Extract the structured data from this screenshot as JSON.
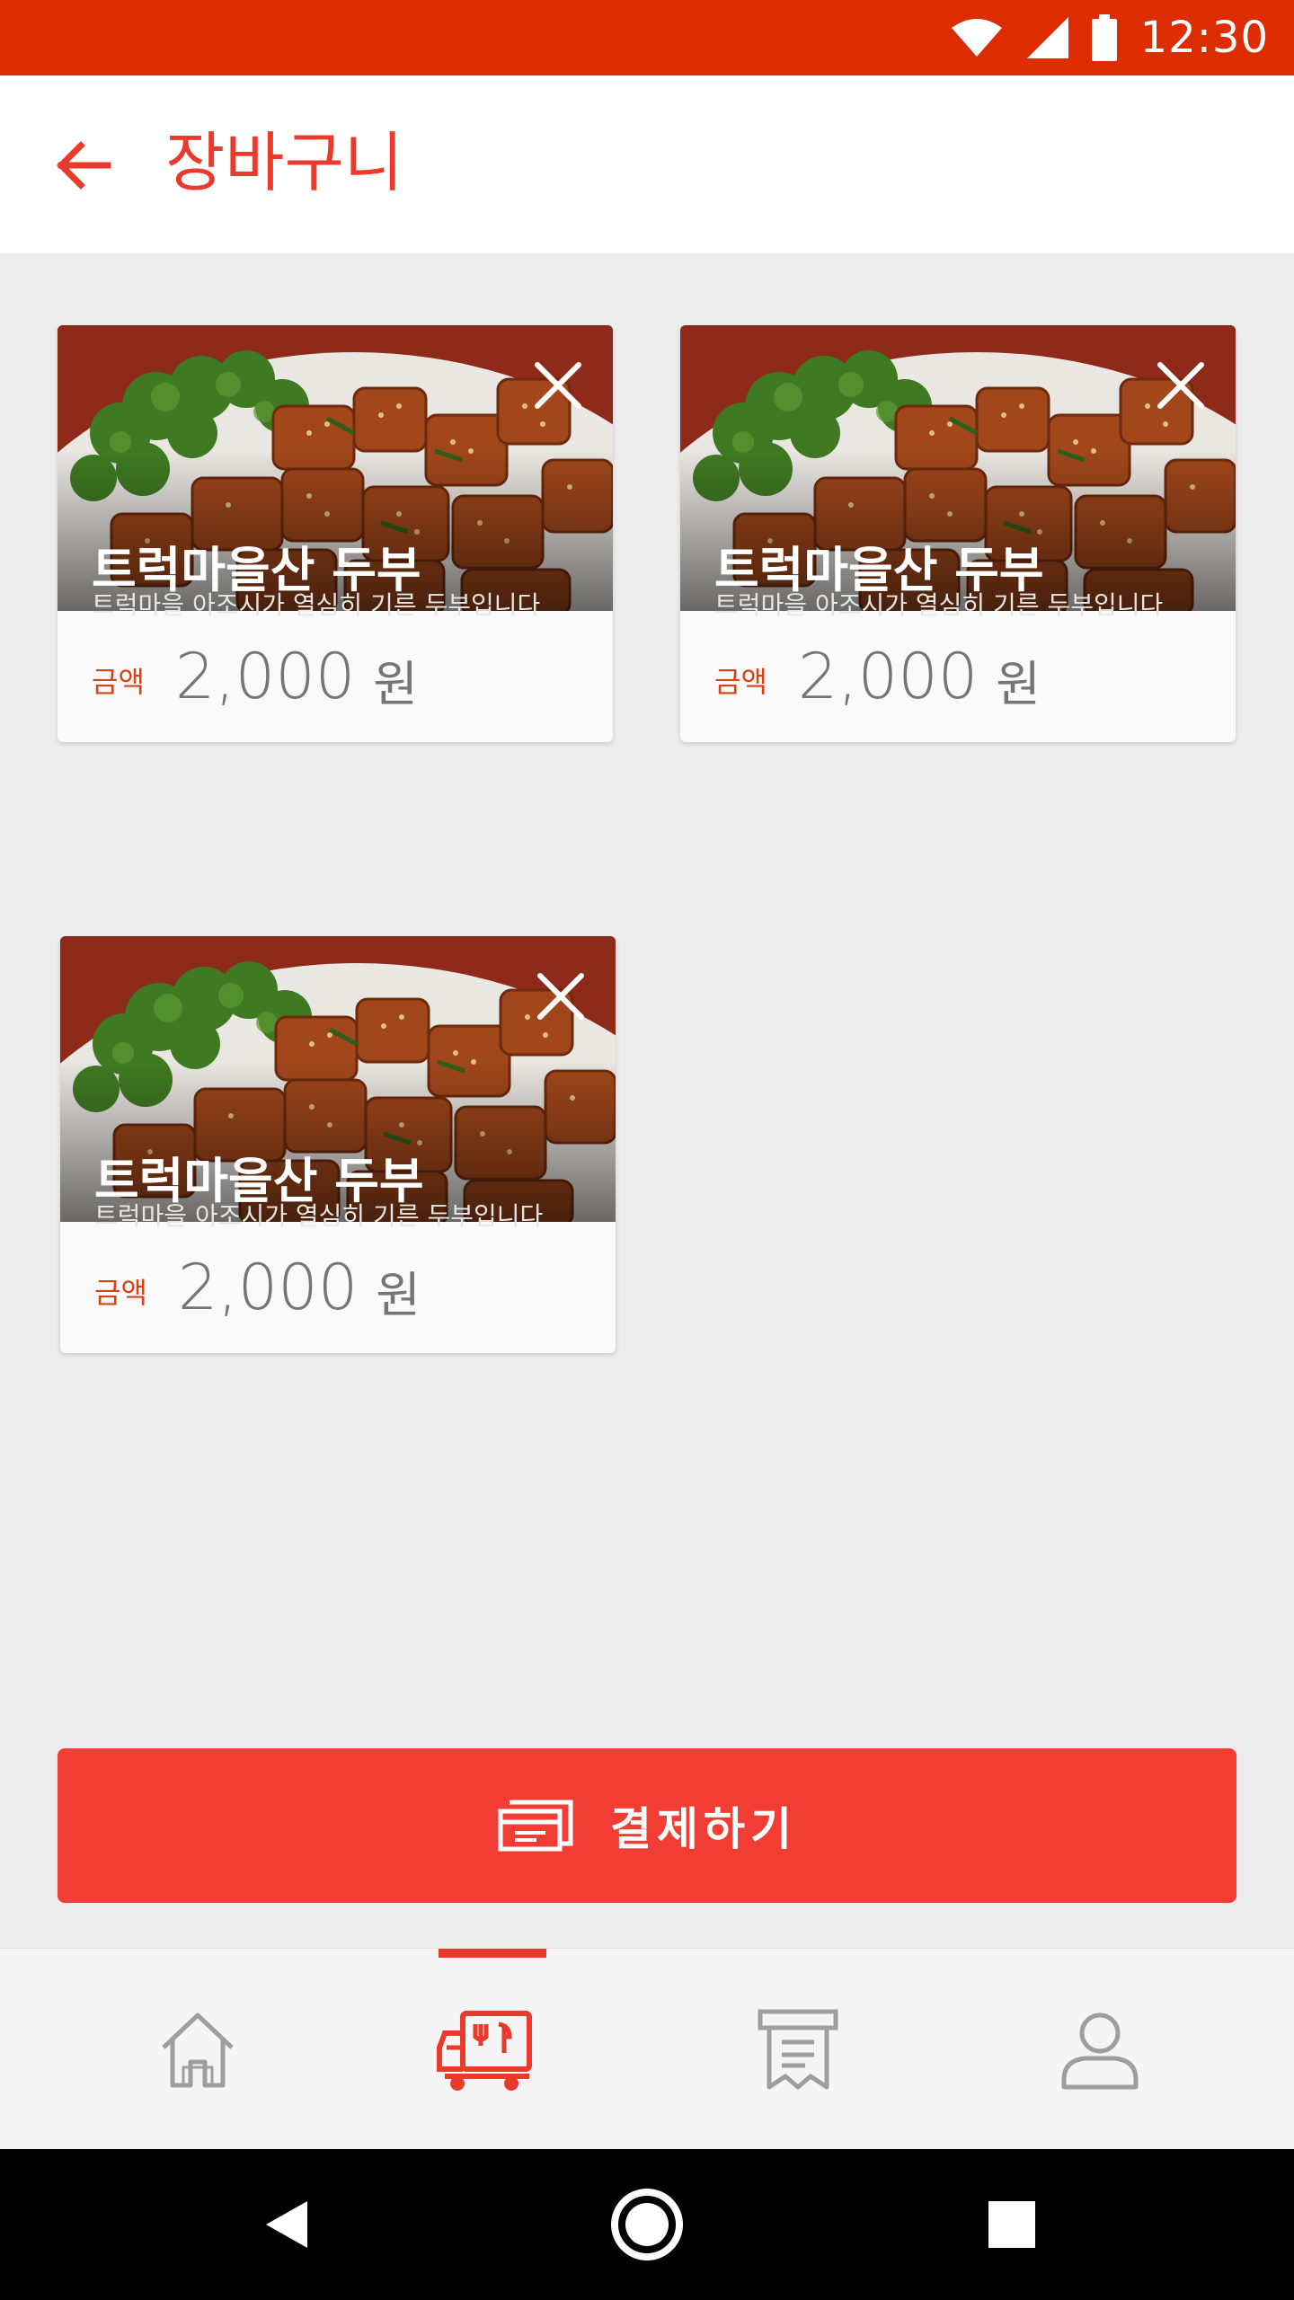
{
  "status_bar": {
    "time": "12:30",
    "icons": [
      "wifi-icon",
      "cellular-signal-icon",
      "battery-icon"
    ]
  },
  "header": {
    "back_icon": "arrow-left-icon",
    "title": "장바구니"
  },
  "cart": {
    "items": [
      {
        "name": "트럭마을산 두부",
        "description": "트럭마을 아조시가 열심히 기른 두부입니다",
        "price_label": "금액",
        "price": "2,000",
        "currency": "원",
        "remove_icon": "close-icon"
      },
      {
        "name": "트럭마을산 두부",
        "description": "트럭마을 아조시가 열심히 기른 두부입니다",
        "price_label": "금액",
        "price": "2,000",
        "currency": "원",
        "remove_icon": "close-icon"
      },
      {
        "name": "트럭마을산 두부",
        "description": "트럭마을 아조시가 열심히 기른 두부입니다",
        "price_label": "금액",
        "price": "2,000",
        "currency": "원",
        "remove_icon": "close-icon"
      }
    ]
  },
  "checkout": {
    "label": "결제하기",
    "icon": "payment-card-icon"
  },
  "bottom_nav": {
    "active_index": 1,
    "items": [
      {
        "icon": "home-icon"
      },
      {
        "icon": "food-truck-icon"
      },
      {
        "icon": "receipt-icon"
      },
      {
        "icon": "person-icon"
      }
    ]
  },
  "system_nav": {
    "icons": [
      "back-triangle-icon",
      "home-circle-icon",
      "recents-square-icon"
    ]
  },
  "colors": {
    "status_bar": "#dd2c00",
    "accent": "#ea3a2c",
    "checkout_button": "#f23d35",
    "price_label": "#d84315",
    "price_text": "#757575",
    "inactive_icon": "#9e9e9e",
    "background": "#ececec"
  }
}
